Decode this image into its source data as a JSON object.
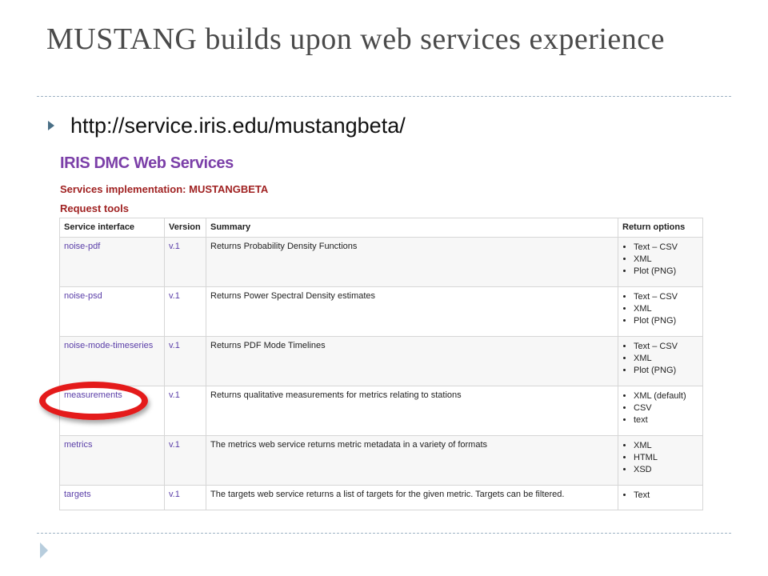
{
  "slide": {
    "title": "MUSTANG builds upon web services experience",
    "bullet": "http://service.iris.edu/mustangbeta/"
  },
  "screenshot": {
    "site_title": "IRIS DMC Web Services",
    "implementation": "Services implementation: MUSTANGBETA",
    "section": "Request tools",
    "columns": [
      "Service interface",
      "Version",
      "Summary",
      "Return options"
    ],
    "rows": [
      {
        "service": "noise-pdf",
        "version": "v.1",
        "summary": "Returns Probability Density Functions",
        "options": [
          "Text – CSV",
          "XML",
          "Plot (PNG)"
        ]
      },
      {
        "service": "noise-psd",
        "version": "v.1",
        "summary": "Returns Power Spectral Density estimates",
        "options": [
          "Text – CSV",
          "XML",
          "Plot (PNG)"
        ]
      },
      {
        "service": "noise-mode-timeseries",
        "version": "v.1",
        "summary": "Returns PDF Mode Timelines",
        "options": [
          "Text – CSV",
          "XML",
          "Plot (PNG)"
        ]
      },
      {
        "service": "measurements",
        "version": "v.1",
        "summary": "Returns qualitative measurements for metrics relating to stations",
        "options": [
          "XML (default)",
          "CSV",
          "text"
        ]
      },
      {
        "service": "metrics",
        "version": "v.1",
        "summary": "The metrics web service returns metric metadata in a variety of formats",
        "options": [
          "XML",
          "HTML",
          "XSD"
        ]
      },
      {
        "service": "targets",
        "version": "v.1",
        "summary": "The targets web service returns a list of targets for the given metric. Targets can be filtered.",
        "options": [
          "Text"
        ]
      }
    ]
  },
  "colors": {
    "site_title": "#7b3fa8",
    "section_headings": "#a02222",
    "links": "#5a3ea8",
    "highlight_ring": "#e41b1b",
    "bullet": "#4a6f86"
  }
}
